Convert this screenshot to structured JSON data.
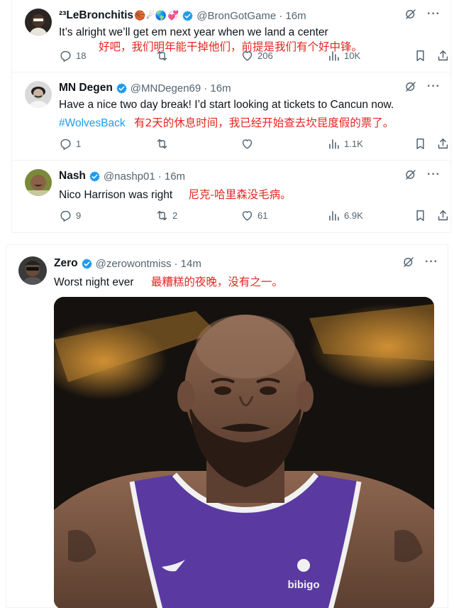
{
  "tweets": [
    {
      "display_name": "²³LeBronchitis",
      "emojis": [
        "🏀",
        "☄",
        "🌎",
        "💞"
      ],
      "handle": "@BronGotGame",
      "time": "· 16m",
      "text": "It’s alright we’ll get em next year when we land a center",
      "translation": "好吧，我们明年能干掉他们，前提是我们有个好中锋。",
      "replies": "18",
      "retweets": "",
      "likes": "206",
      "views": "10K"
    },
    {
      "display_name": "MN Degen",
      "handle": "@MNDegen69",
      "time": "· 16m",
      "text": "Have a nice two day break!  I’d start looking at tickets to Cancun now.",
      "hashtag": "#WolvesBack",
      "translation": "有2天的休息时间，我已经开始查去坎昆度假的票了。",
      "replies": "1",
      "retweets": "",
      "likes": "",
      "views": "1.1K"
    },
    {
      "display_name": "Nash",
      "handle": "@nashp01",
      "time": "· 16m",
      "text": "Nico Harrison was right",
      "translation": "尼克-哈里森没毛病。",
      "replies": "9",
      "retweets": "2",
      "likes": "61",
      "views": "6.9K"
    },
    {
      "display_name": "Zero",
      "handle": "@zerowontmiss",
      "time": "· 14m",
      "text": "Worst night ever",
      "translation": "最糟糕的夜晚，没有之一。"
    }
  ],
  "media": {
    "jersey_text": "bibigo"
  },
  "colors": {
    "accent": "#1d9bf0",
    "muted": "#536471",
    "translation": "#e3261f",
    "jersey": "#5a3aa0"
  },
  "icons": [
    "reply-icon",
    "retweet-icon",
    "like-icon",
    "views-icon",
    "bookmark-icon",
    "share-icon",
    "grok-icon",
    "more-icon",
    "verified-badge-icon"
  ]
}
